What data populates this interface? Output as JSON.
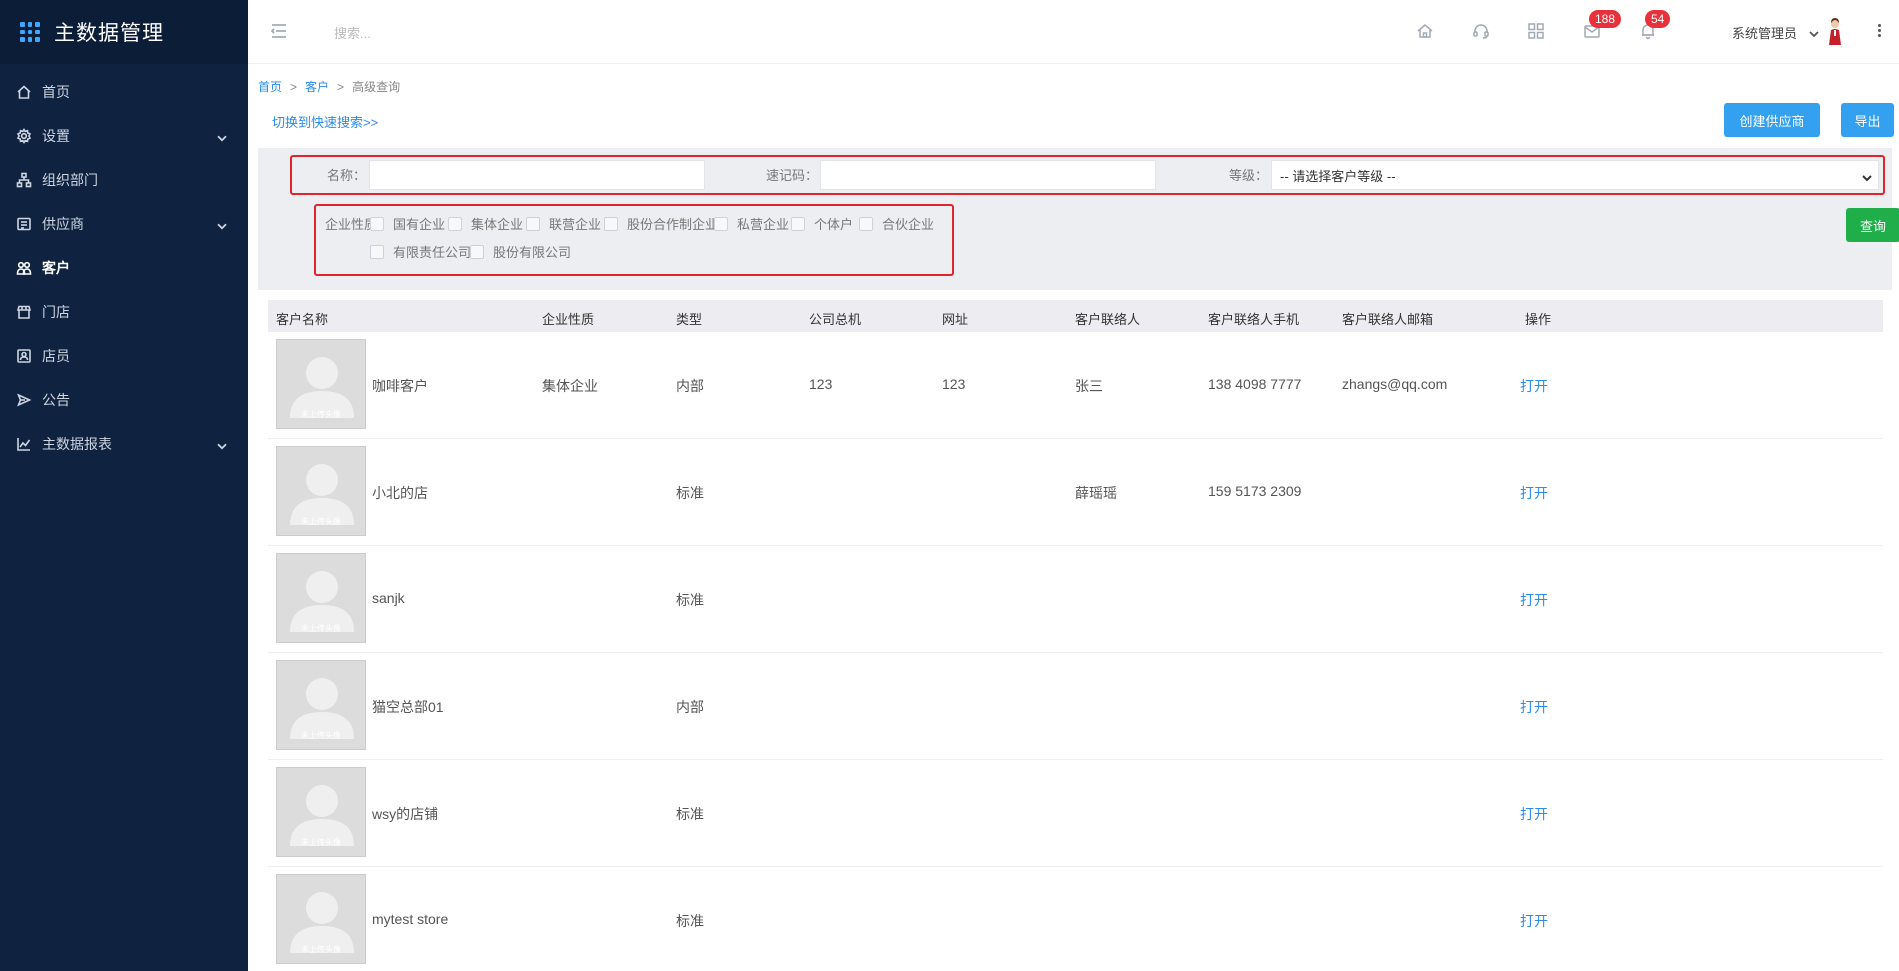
{
  "app": {
    "title": "主数据管理"
  },
  "sidebar": {
    "items": [
      {
        "label": "首页",
        "icon": "home-icon",
        "has_children": false,
        "active": false
      },
      {
        "label": "设置",
        "icon": "gear-icon",
        "has_children": true,
        "active": false
      },
      {
        "label": "组织部门",
        "icon": "org-tree-icon",
        "has_children": false,
        "active": false
      },
      {
        "label": "供应商",
        "icon": "supplier-icon",
        "has_children": true,
        "active": false
      },
      {
        "label": "客户",
        "icon": "customer-icon",
        "has_children": false,
        "active": true
      },
      {
        "label": "门店",
        "icon": "store-icon",
        "has_children": false,
        "active": false
      },
      {
        "label": "店员",
        "icon": "clerk-icon",
        "has_children": false,
        "active": false
      },
      {
        "label": "公告",
        "icon": "announcement-icon",
        "has_children": false,
        "active": false
      },
      {
        "label": "主数据报表",
        "icon": "chart-icon",
        "has_children": true,
        "active": false
      }
    ]
  },
  "header": {
    "search_placeholder": "搜索...",
    "messages_badge": "188",
    "notifications_badge": "54",
    "user_name": "系统管理员"
  },
  "breadcrumb": {
    "home": "首页",
    "section": "客户",
    "current": "高级查询",
    "separator": ">"
  },
  "toolbar": {
    "switch_link": "切换到快速搜索>>",
    "create_button": "创建供应商",
    "export_button": "导出",
    "query_button": "查询"
  },
  "filters": {
    "name_label": "名称：",
    "name_value": "",
    "code_label": "速记码：",
    "code_value": "",
    "level_label": "等级：",
    "level_selected": "-- 请选择客户等级 --",
    "nature_label": "企业性质：",
    "nature_options": [
      "国有企业",
      "集体企业",
      "联营企业",
      "股份合作制企业",
      "私营企业",
      "个体户",
      "合伙企业",
      "有限责任公司",
      "股份有限公司"
    ]
  },
  "table": {
    "headers": [
      "客户名称",
      "企业性质",
      "类型",
      "公司总机",
      "网址",
      "客户联络人",
      "客户联络人手机",
      "客户联络人邮箱",
      "操作"
    ],
    "thumb_caption": "未上传头像",
    "rows": [
      {
        "name": "咖啡客户",
        "nature": "集体企业",
        "type": "内部",
        "phone": "123",
        "website": "123",
        "contact": "张三",
        "mobile": "138 4098 7777",
        "email": "zhangs@qq.com",
        "action": "打开"
      },
      {
        "name": "小北的店",
        "nature": "",
        "type": "标准",
        "phone": "",
        "website": "",
        "contact": "薛瑶瑶",
        "mobile": "159 5173 2309",
        "email": "",
        "action": "打开"
      },
      {
        "name": "sanjk",
        "nature": "",
        "type": "标准",
        "phone": "",
        "website": "",
        "contact": "",
        "mobile": "",
        "email": "",
        "action": "打开"
      },
      {
        "name": "猫空总部01",
        "nature": "",
        "type": "内部",
        "phone": "",
        "website": "",
        "contact": "",
        "mobile": "",
        "email": "",
        "action": "打开"
      },
      {
        "name": "wsy的店铺",
        "nature": "",
        "type": "标准",
        "phone": "",
        "website": "",
        "contact": "",
        "mobile": "",
        "email": "",
        "action": "打开"
      },
      {
        "name": "mytest store",
        "nature": "",
        "type": "标准",
        "phone": "",
        "website": "",
        "contact": "",
        "mobile": "",
        "email": "",
        "action": "打开"
      }
    ]
  },
  "colors": {
    "sidebar_bg": "#0f2240",
    "accent_blue": "#33a1f0",
    "query_green": "#1fae4a",
    "badge_red": "#e8313b",
    "highlight_red": "#e0242d",
    "link_blue": "#2a8ceb"
  }
}
